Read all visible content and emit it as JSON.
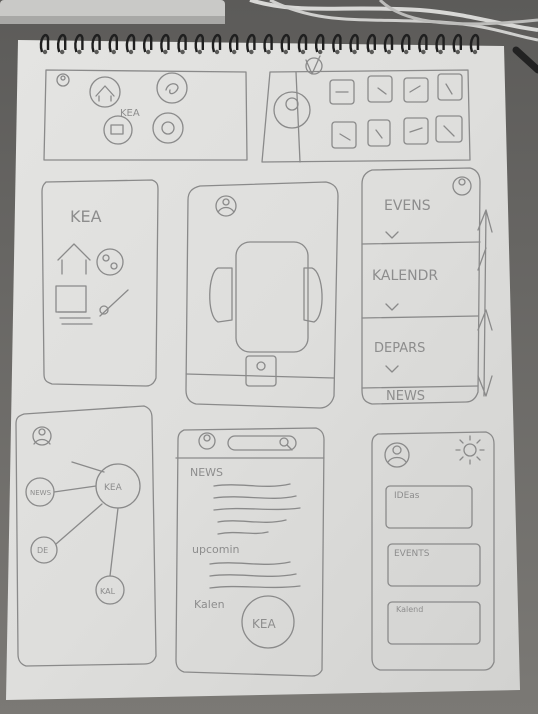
{
  "screens": {
    "home_logo": "KEA",
    "splash_logo": "KEA",
    "menu_items": [
      "EVENS",
      "KALENDR",
      "DEPARS",
      "NEWS"
    ],
    "mindmap_center": "KEA",
    "mindmap_nodes": [
      "NEWS",
      "DE",
      "KAL"
    ],
    "feed_sections": [
      "NEWS",
      "upcomin",
      "Kalen"
    ],
    "feed_badge": "KEA",
    "card_labels": [
      "IDEas",
      "EVENTS",
      "Kalend"
    ]
  }
}
